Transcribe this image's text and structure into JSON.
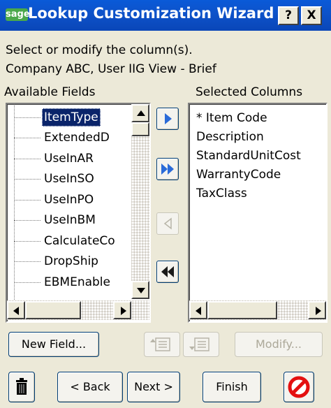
{
  "window": {
    "logo": "sage",
    "title": "Lookup Customization Wizard",
    "help_label": "?",
    "close_label": "X"
  },
  "instructions": {
    "line1": "Select or modify the column(s).",
    "line2": "Company ABC, User IIG View - Brief"
  },
  "available": {
    "label": "Available Fields",
    "items": [
      "ItemType",
      "ExtendedD",
      "UseInAR",
      "UseInSO",
      "UseInPO",
      "UseInBM",
      "CalculateCo",
      "DropShip",
      "EBMEnable"
    ],
    "selected_index": 0
  },
  "selected": {
    "label": "Selected Columns",
    "items": [
      "* Item Code",
      "Description",
      "StandardUnitCost",
      "WarrantyCode",
      "TaxClass"
    ]
  },
  "buttons": {
    "new_field": "New Field...",
    "modify": "Modify...",
    "back": "< Back",
    "next": "Next >",
    "finish": "Finish"
  },
  "icons": {
    "add": "arrow-right-icon",
    "add_all": "double-arrow-right-icon",
    "remove": "arrow-left-icon",
    "remove_all": "double-arrow-left-icon",
    "delete": "trash-icon",
    "cancel": "cancel-icon"
  },
  "colors": {
    "titlebar": "#0a5ad8",
    "selection": "#0a246a",
    "arrow_blue": "#2a6ad8",
    "cancel_red": "#e41010"
  }
}
